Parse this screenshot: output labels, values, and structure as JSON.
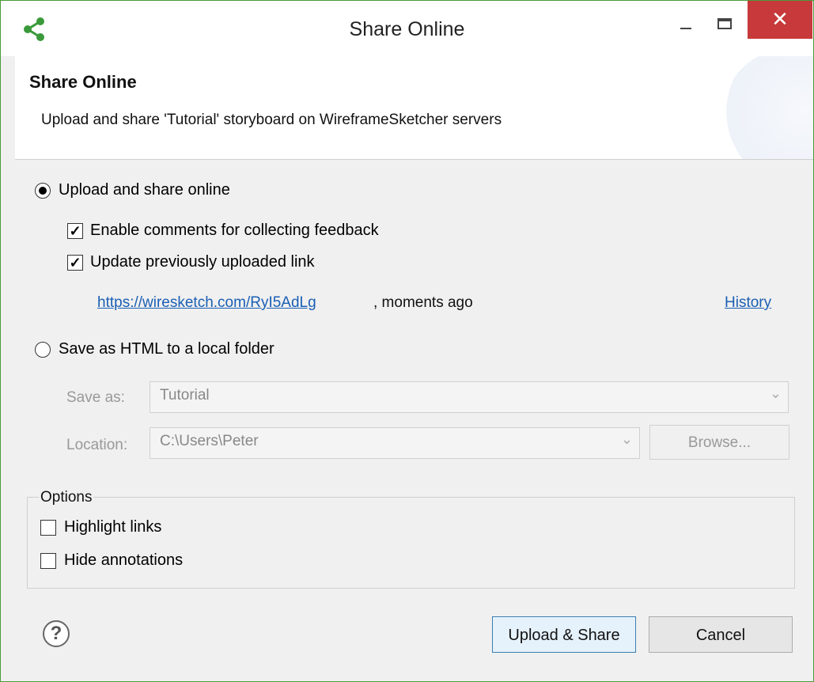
{
  "window": {
    "title": "Share Online",
    "close_glyph": "✕"
  },
  "header": {
    "title": "Share Online",
    "description": "Upload and share 'Tutorial' storyboard on WireframeSketcher servers"
  },
  "upload": {
    "radio_label": "Upload and share online",
    "selected": true,
    "enable_comments_label": "Enable comments for collecting feedback",
    "enable_comments_checked": true,
    "update_link_label": "Update previously uploaded link",
    "update_link_checked": true,
    "link_url": "https://wiresketch.com/RyI5AdLg",
    "link_suffix": ", moments ago",
    "history_label": "History"
  },
  "save_html": {
    "radio_label": "Save as HTML to a local folder",
    "selected": false,
    "save_as_label": "Save as:",
    "save_as_value": "Tutorial",
    "location_label": "Location:",
    "location_value": "C:\\Users\\Peter",
    "browse_label": "Browse..."
  },
  "options": {
    "title": "Options",
    "highlight_links_label": "Highlight links",
    "highlight_links_checked": false,
    "hide_annotations_label": "Hide annotations",
    "hide_annotations_checked": false
  },
  "footer": {
    "help_glyph": "?",
    "upload_button": "Upload & Share",
    "cancel_button": "Cancel"
  },
  "glyphs": {
    "check": "✓",
    "dropdown": "⌄"
  },
  "colors": {
    "accent_link": "#1a5fb4",
    "close_button": "#c7393a",
    "app_icon": "#3a9a3a"
  }
}
